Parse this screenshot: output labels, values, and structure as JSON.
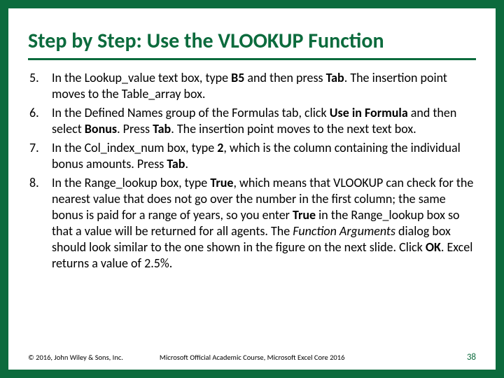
{
  "title": "Step by Step: Use the VLOOKUP Function",
  "items": [
    {
      "num": "5.",
      "html": "In the Lookup_value text box, type <b>B5</b> and then press <b>Tab</b>. The insertion point moves to the Table_array box."
    },
    {
      "num": "6.",
      "html": "In the Defined Names group of the Formulas tab, click <b>Use in Formula</b> and then select <b>Bonus</b>. Press <b>Tab</b>. The insertion point moves to the next text box."
    },
    {
      "num": "7.",
      "html": "In the Col_index_num box, type <b>2</b>, which is the column containing the individual bonus amounts. Press <b>Tab</b>."
    },
    {
      "num": "8.",
      "html": "In the Range_lookup box, type <b>True</b>, which means that VLOOKUP can check for the nearest value that does not go over the number in the first column; the same bonus is paid for a range of years, so you enter <b>True</b> in the Range_lookup box so that a value will be returned for all agents. The <i>Function Arguments</i> dialog box should look similar to the one shown in the figure on the next slide. Click <b>OK</b>. Excel returns a value of 2.5%."
    }
  ],
  "footer": {
    "copyright": "© 2016, John Wiley & Sons, Inc.",
    "course": "Microsoft Official Academic Course, Microsoft Excel Core 2016",
    "page": "38"
  }
}
